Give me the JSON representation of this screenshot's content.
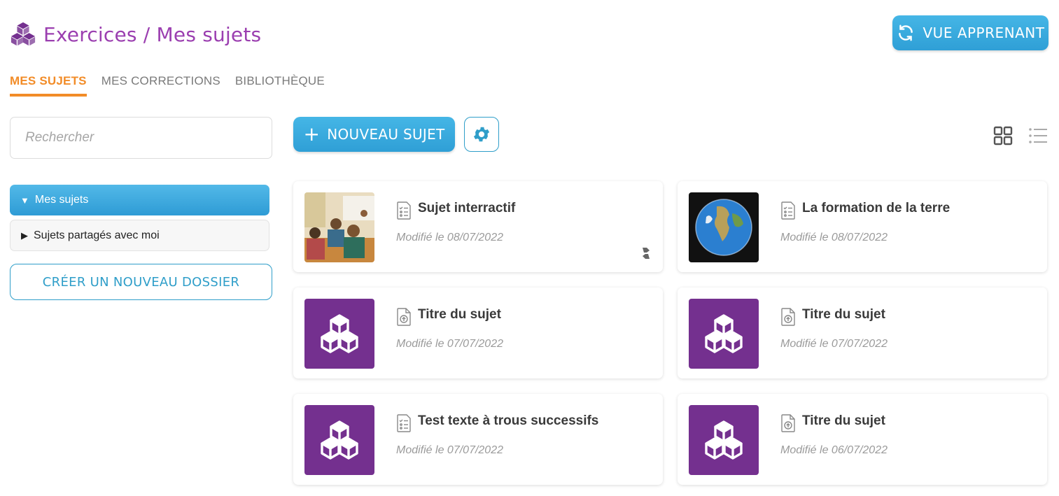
{
  "header": {
    "title": "Exercices / Mes sujets",
    "logo_icon": "cubes-icon"
  },
  "learner_view_button": {
    "label": "VUE APPRENANT",
    "icon": "refresh-icon"
  },
  "tabs": [
    {
      "label": "MES SUJETS",
      "active": true
    },
    {
      "label": "MES CORRECTIONS",
      "active": false
    },
    {
      "label": "BIBLIOTHÈQUE",
      "active": false
    }
  ],
  "search": {
    "placeholder": "Rechercher",
    "value": ""
  },
  "folders": [
    {
      "label": "Mes sujets",
      "expanded": true,
      "active": true
    },
    {
      "label": "Sujets partagés avec moi",
      "expanded": false,
      "active": false
    }
  ],
  "new_folder_button": {
    "label": "CRÉER UN NOUVEAU DOSSIER"
  },
  "toolbar": {
    "new_subject_label": "NOUVEAU SUJET",
    "settings_icon": "gear-icon",
    "grid_view_icon": "grid-icon",
    "list_view_icon": "list-icon"
  },
  "cards": [
    {
      "title": "Sujet interractif",
      "date": "Modifié le 08/07/2022",
      "thumbnail": "classroom-photo",
      "doc_icon": "checklist-doc-icon",
      "shared": true
    },
    {
      "title": "La formation de la terre",
      "date": "Modifié le 08/07/2022",
      "thumbnail": "earth-photo",
      "doc_icon": "checklist-doc-icon",
      "shared": false
    },
    {
      "title": "Titre du sujet",
      "date": "Modifié le 07/07/2022",
      "thumbnail": "cubes-placeholder",
      "doc_icon": "upload-doc-icon",
      "shared": false
    },
    {
      "title": "Titre du sujet",
      "date": "Modifié le 07/07/2022",
      "thumbnail": "cubes-placeholder",
      "doc_icon": "upload-doc-icon",
      "shared": false
    },
    {
      "title": "Test texte à trous successifs",
      "date": "Modifié le 07/07/2022",
      "thumbnail": "cubes-placeholder",
      "doc_icon": "checklist-doc-icon",
      "shared": false
    },
    {
      "title": "Titre du sujet",
      "date": "Modifié le 06/07/2022",
      "thumbnail": "cubes-placeholder",
      "doc_icon": "upload-doc-icon",
      "shared": false
    }
  ],
  "colors": {
    "brand_purple": "#9b3fb0",
    "accent_blue": "#3aaee0",
    "tab_orange": "#f28c28",
    "thumb_purple": "#74308f"
  }
}
